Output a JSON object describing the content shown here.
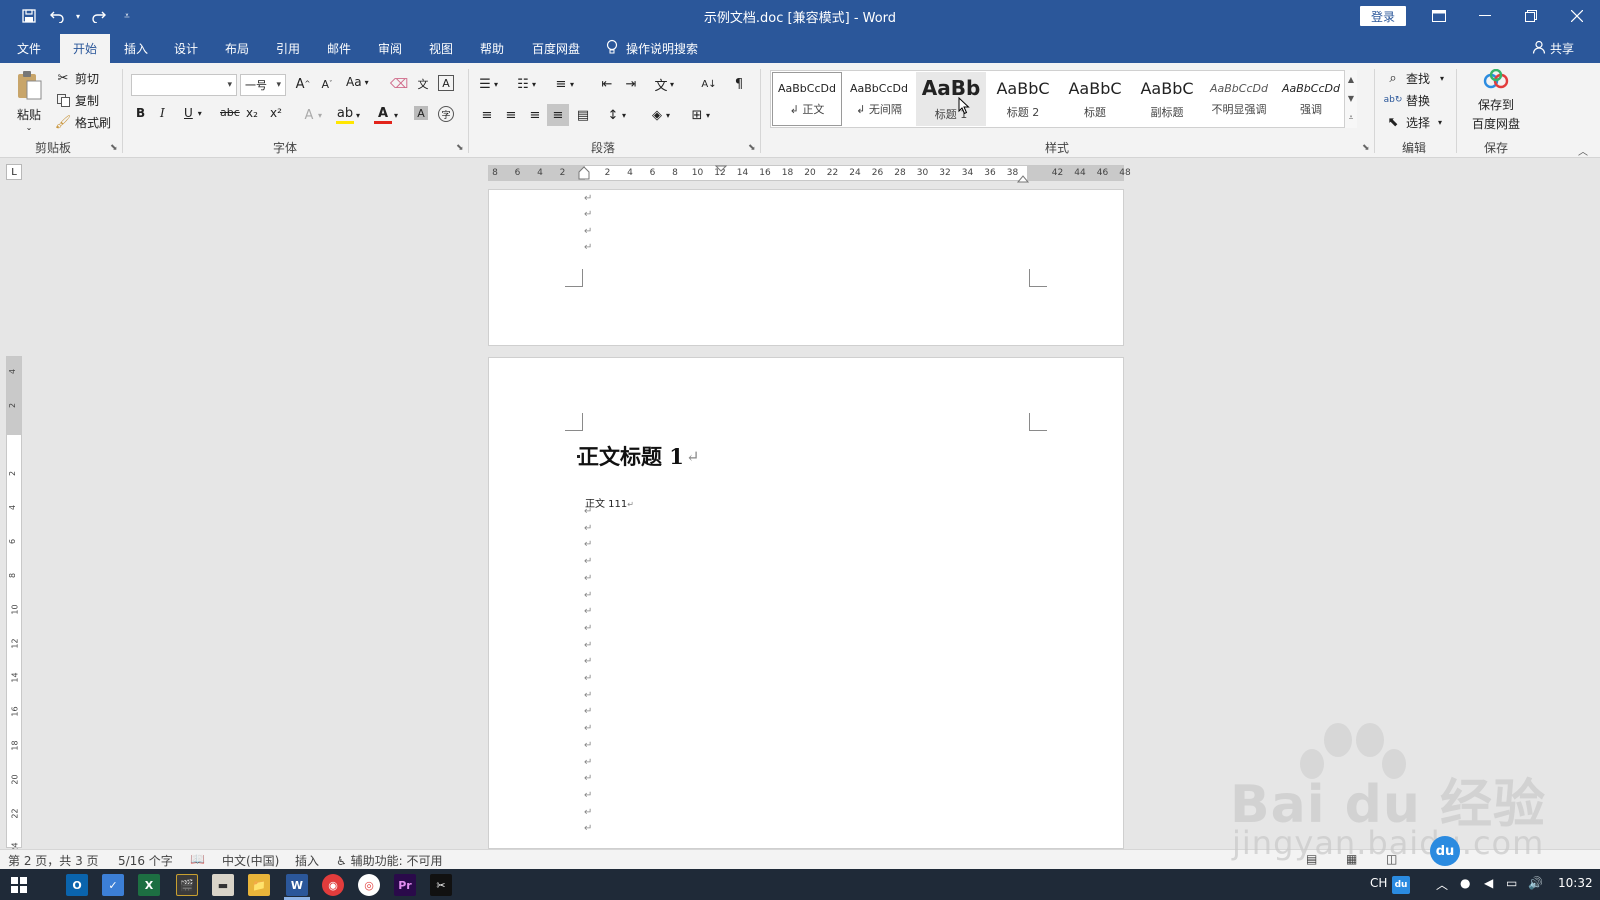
{
  "window": {
    "title": "示例文档.doc [兼容模式]  -  Word",
    "login_label": "登录"
  },
  "ribbon_tabs": [
    {
      "label": "文件"
    },
    {
      "label": "开始"
    },
    {
      "label": "插入"
    },
    {
      "label": "设计"
    },
    {
      "label": "布局"
    },
    {
      "label": "引用"
    },
    {
      "label": "邮件"
    },
    {
      "label": "审阅"
    },
    {
      "label": "视图"
    },
    {
      "label": "帮助"
    },
    {
      "label": "百度网盘"
    }
  ],
  "tell_me": "操作说明搜索",
  "share_label": "共享",
  "clipboard": {
    "paste": "粘贴",
    "cut": "剪切",
    "copy": "复制",
    "format_painter": "格式刷",
    "group": "剪贴板"
  },
  "font": {
    "size_value": "一号",
    "case_label": "Aa",
    "bold": "B",
    "italic": "I",
    "underline": "U",
    "strike": "abc",
    "subscript": "x₂",
    "superscript": "x²",
    "group": "字体"
  },
  "paragraph": {
    "group": "段落"
  },
  "styles": {
    "group": "样式",
    "items": [
      {
        "preview": "AaBbCcDd",
        "name": "↲ 正文"
      },
      {
        "preview": "AaBbCcDd",
        "name": "↲ 无间隔"
      },
      {
        "preview": "AaBb",
        "name": "标题 1"
      },
      {
        "preview": "AaBbC",
        "name": "标题 2"
      },
      {
        "preview": "AaBbC",
        "name": "标题"
      },
      {
        "preview": "AaBbC",
        "name": "副标题"
      },
      {
        "preview": "AaBbCcDd",
        "name": "不明显强调"
      },
      {
        "preview": "AaBbCcDd",
        "name": "强调"
      }
    ]
  },
  "editing": {
    "find": "查找",
    "replace": "替换",
    "select": "选择",
    "group": "编辑"
  },
  "save_group": {
    "button": "保存到\n百度网盘",
    "line1": "保存到",
    "line2": "百度网盘",
    "group": "保存"
  },
  "ruler": {
    "numbers": [
      "8",
      "6",
      "4",
      "2",
      "",
      "2",
      "4",
      "6",
      "8",
      "10",
      "12",
      "14",
      "16",
      "18",
      "20",
      "22",
      "24",
      "26",
      "28",
      "30",
      "32",
      "34",
      "36",
      "38",
      "",
      "42",
      "44",
      "46",
      "48"
    ],
    "vertical_numbers": [
      "4",
      "2",
      "",
      "2",
      "4",
      "6",
      "8",
      "10",
      "12",
      "14",
      "16",
      "18",
      "20",
      "22",
      "24"
    ]
  },
  "document": {
    "heading": "正文标题 1",
    "body": "正文 111",
    "paragraph_mark": "↵"
  },
  "status": {
    "page": "第 2 页，共 3 页",
    "words": "5/16 个字",
    "language": "中文(中国)",
    "mode": "插入",
    "accessibility": "辅助功能: 不可用"
  },
  "taskbar": {
    "ime": "CH",
    "time": "10:32"
  },
  "watermark": {
    "brand": "Bai du 经验",
    "url": "jingyan.baidu.com"
  },
  "colors": {
    "accent": "#2b579a",
    "ribbon_bg": "#f3f3f3",
    "canvas_bg": "#e6e6e6",
    "taskbar_bg": "#1f2a38"
  }
}
